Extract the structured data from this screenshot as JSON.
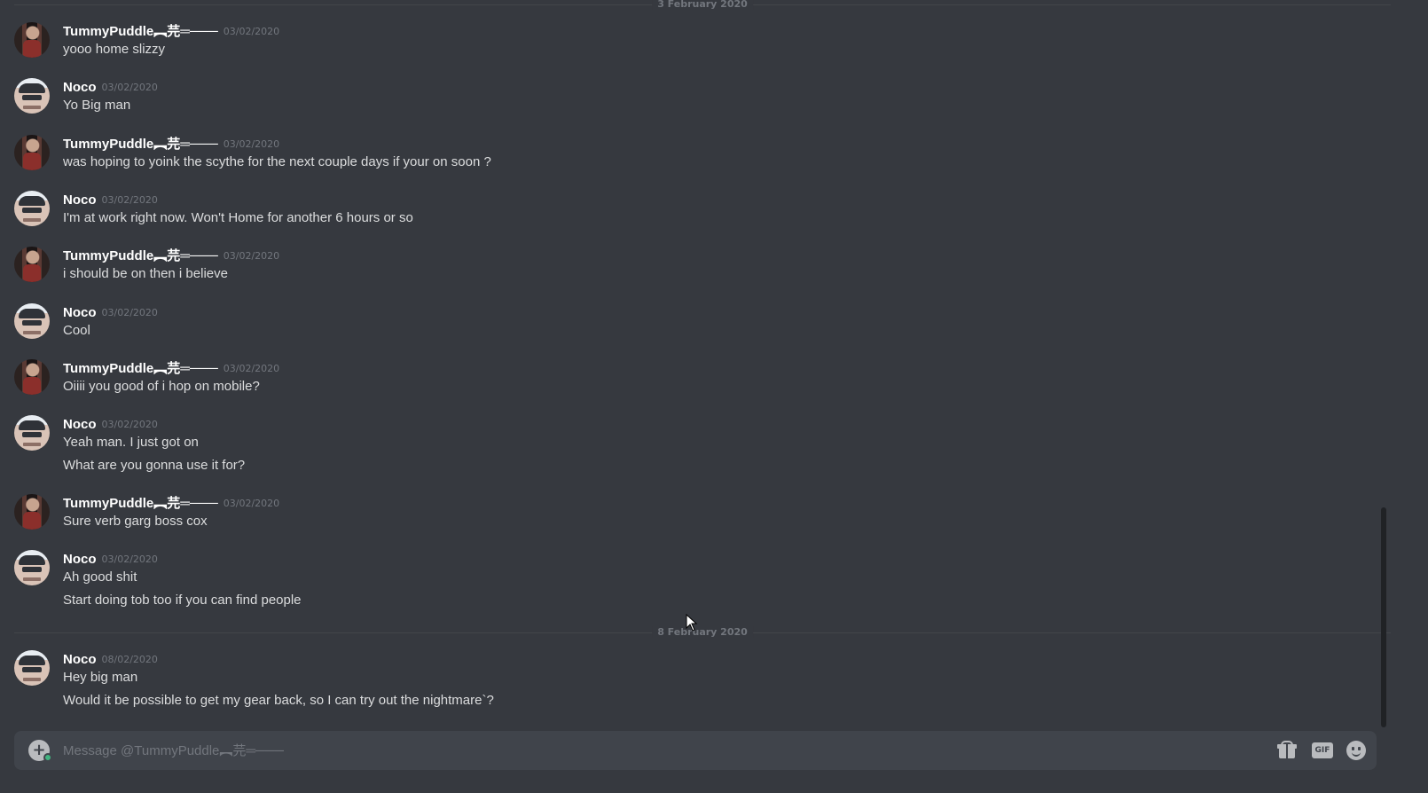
{
  "channel": {
    "recipient": "TummyPuddle︻芫═───",
    "composer_placeholder": "Message @TummyPuddle︻芫═───"
  },
  "dividers": [
    {
      "label": "3 February 2020"
    },
    {
      "label": "8 February 2020"
    }
  ],
  "messages": [
    {
      "author": "TummyPuddle︻芫═───",
      "avatar": "tummypuddle-avatar",
      "time": "03/02/2020",
      "lines": [
        "yooo home slizzy"
      ]
    },
    {
      "author": "Noco",
      "avatar": "noco-avatar",
      "time": "03/02/2020",
      "lines": [
        "Yo Big man"
      ]
    },
    {
      "author": "TummyPuddle︻芫═───",
      "avatar": "tummypuddle-avatar",
      "time": "03/02/2020",
      "lines": [
        "was hoping to yoink the scythe for the next couple days if your on soon ?"
      ]
    },
    {
      "author": "Noco",
      "avatar": "noco-avatar",
      "time": "03/02/2020",
      "lines": [
        "I'm at work right now. Won't Home for another 6 hours or so"
      ]
    },
    {
      "author": "TummyPuddle︻芫═───",
      "avatar": "tummypuddle-avatar",
      "time": "03/02/2020",
      "lines": [
        "i should be on then i believe"
      ]
    },
    {
      "author": "Noco",
      "avatar": "noco-avatar",
      "time": "03/02/2020",
      "lines": [
        "Cool"
      ]
    },
    {
      "author": "TummyPuddle︻芫═───",
      "avatar": "tummypuddle-avatar",
      "time": "03/02/2020",
      "lines": [
        "Oiiii you good of i hop on mobile?"
      ]
    },
    {
      "author": "Noco",
      "avatar": "noco-avatar",
      "time": "03/02/2020",
      "lines": [
        "Yeah man. I just got on",
        "What are you gonna use it for?"
      ]
    },
    {
      "author": "TummyPuddle︻芫═───",
      "avatar": "tummypuddle-avatar",
      "time": "03/02/2020",
      "lines": [
        "Sure verb garg boss cox"
      ]
    },
    {
      "author": "Noco",
      "avatar": "noco-avatar",
      "time": "03/02/2020",
      "lines": [
        "Ah good shit",
        "Start doing tob too if you can find people"
      ]
    },
    {
      "author": "Noco",
      "avatar": "noco-avatar",
      "time": "08/02/2020",
      "lines": [
        "Hey big man",
        "Would it be possible to get my gear back, so I can try out the nightmare`?"
      ]
    }
  ],
  "toolbar": {
    "attach_icon": "plus-circle-icon",
    "gift_icon": "gift-icon",
    "gif_label": "GIF",
    "emoji_icon": "emoji-icon"
  }
}
